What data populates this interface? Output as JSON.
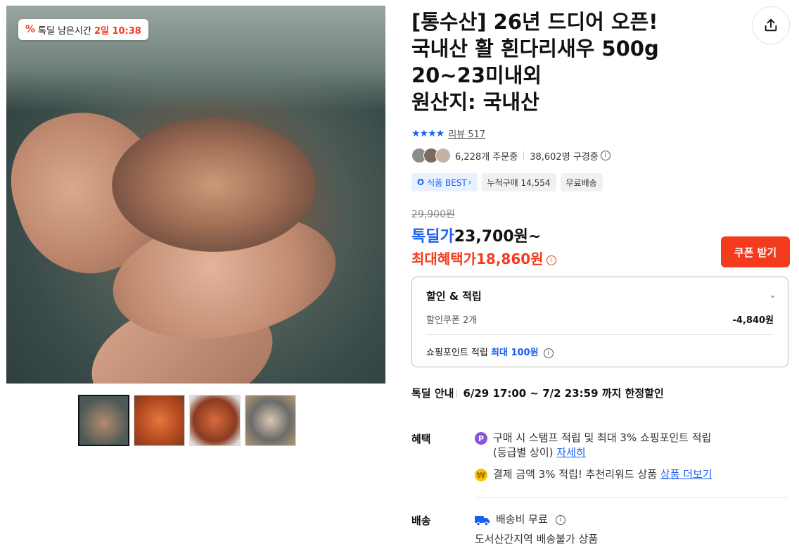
{
  "deal_badge": {
    "label": "톡딜 남은시간",
    "time": "2일 10:38"
  },
  "product": {
    "title_lines": [
      "[통수산] 26년 드디어 오픈!",
      "국내산 활 흰다리새우 500g",
      "20~23미내외",
      "원산지: 국내산"
    ],
    "rating_stars": "★★★★",
    "review_link": "리뷰 517",
    "orders": "6,228개 주문중",
    "viewers": "38,602명 구경중",
    "badges": [
      "식품 BEST",
      "누적구매 14,554",
      "무료배송"
    ],
    "original_price": "29,900원",
    "deal_label": "톡딜가",
    "deal_price": "23,700원~",
    "max_label": "최대혜택가",
    "max_price": "18,860원",
    "coupon_button": "쿠폰 받기"
  },
  "discount": {
    "title": "할인 & 적립",
    "coupon_label": "할인쿠폰 2개",
    "coupon_value": "-4,840원",
    "point_label": "쇼핑포인트 적립",
    "point_value": "최대 100원"
  },
  "deal_info": {
    "label": "톡딜 안내",
    "value": "6/29 17:00 ~ 7/2 23:59 까지 한정할인"
  },
  "benefits": {
    "label": "혜택",
    "line1": "구매 시 스탬프 적립 및 최대 3% 쇼핑포인트 적립",
    "line1b": "(등급별 상이)",
    "line1_link": "자세히",
    "line2": "결제 금액 3% 적립! 추천리워드 상품",
    "line2_link": "상품 더보기"
  },
  "shipping": {
    "label": "배송",
    "line1": "배송비 무료",
    "line2": "도서산간지역 배송불가 상품"
  }
}
